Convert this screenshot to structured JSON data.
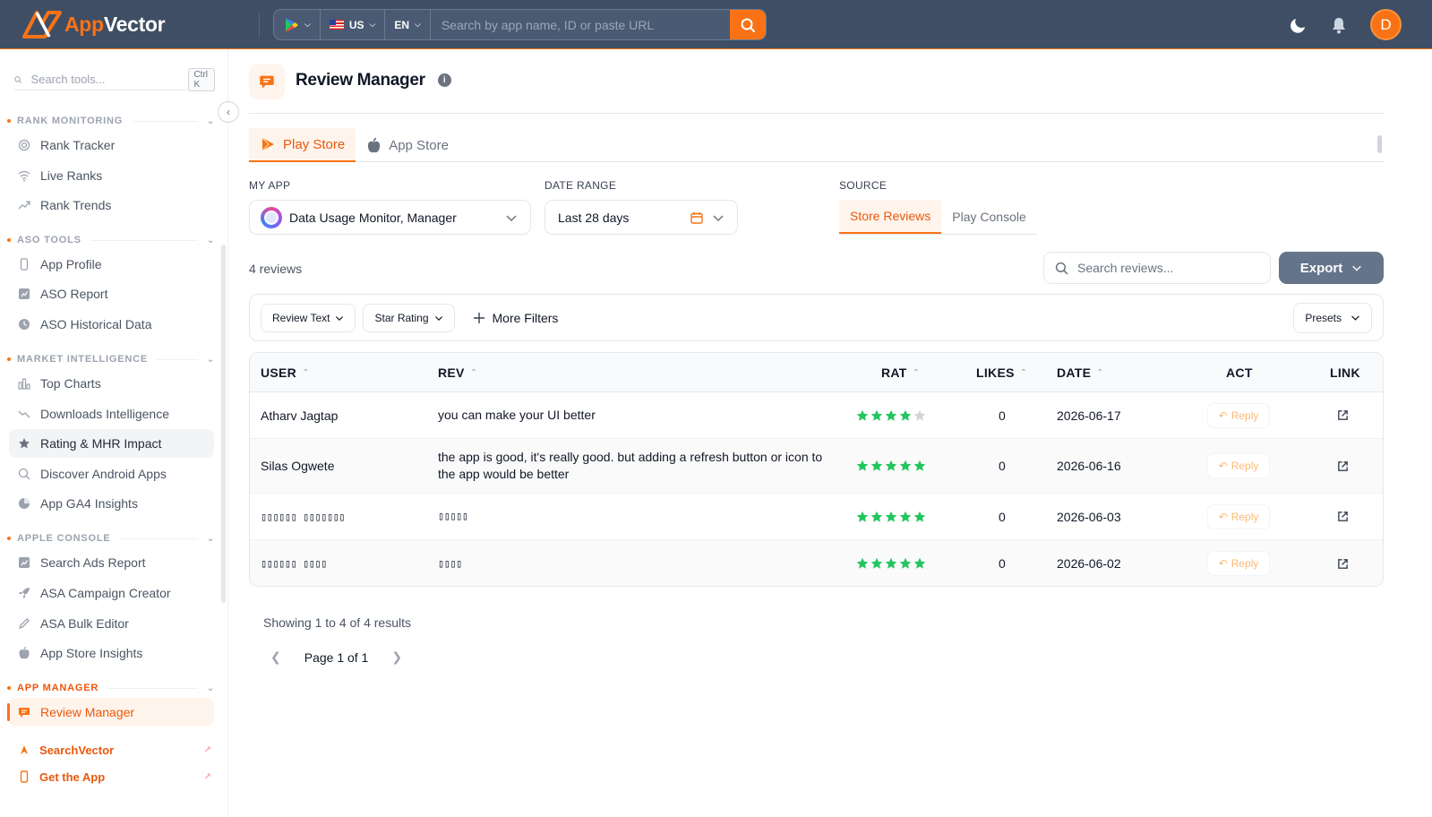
{
  "brand": {
    "name_part1": "App",
    "name_part2": "Vector"
  },
  "topbar": {
    "country": "US",
    "language": "EN",
    "search_placeholder": "Search by app name, ID or paste URL",
    "avatar_initial": "D"
  },
  "sidebar": {
    "search_placeholder": "Search tools...",
    "shortcut": "Ctrl K",
    "sections": {
      "rank": {
        "title": "RANK MONITORING",
        "items": [
          "Rank Tracker",
          "Live Ranks",
          "Rank Trends"
        ]
      },
      "aso": {
        "title": "ASO TOOLS",
        "items": [
          "App Profile",
          "ASO Report",
          "ASO Historical Data"
        ]
      },
      "market": {
        "title": "MARKET INTELLIGENCE",
        "items": [
          "Top Charts",
          "Downloads Intelligence",
          "Rating & MHR Impact",
          "Discover Android Apps",
          "App GA4 Insights"
        ]
      },
      "apple": {
        "title": "APPLE CONSOLE",
        "items": [
          "Search Ads Report",
          "ASA Campaign Creator",
          "ASA Bulk Editor",
          "App Store Insights"
        ]
      },
      "manager": {
        "title": "APP MANAGER",
        "items": [
          "Review Manager"
        ]
      }
    },
    "footer": [
      "SearchVector",
      "Get the App"
    ]
  },
  "page": {
    "title": "Review Manager",
    "store_tabs": [
      "Play Store",
      "App Store"
    ],
    "my_app_label": "MY APP",
    "my_app_value": "Data Usage Monitor, Manager",
    "date_label": "DATE RANGE",
    "date_value": "Last 28 days",
    "source_label": "SOURCE",
    "source_tabs": [
      "Store Reviews",
      "Play Console"
    ],
    "review_count": "4 reviews",
    "search_placeholder": "Search reviews...",
    "export_label": "Export",
    "filters": [
      "Review Text",
      "Star Rating"
    ],
    "more_filters": "More Filters",
    "presets": "Presets"
  },
  "table": {
    "columns": [
      "USER",
      "REV",
      "RAT",
      "LIKES",
      "DATE",
      "ACT",
      "LINK"
    ],
    "reply_label": "Reply",
    "rows": [
      {
        "user": "Atharv Jagtap",
        "review": "you can make your UI better",
        "rating": 4,
        "likes": "0",
        "date": "2026-06-17"
      },
      {
        "user": "Silas Ogwete",
        "review": "the app is good, it's really good. but adding a refresh button or icon to the app would be better",
        "rating": 5,
        "likes": "0",
        "date": "2026-06-16"
      },
      {
        "user": "▯▯▯▯▯▯ ▯▯▯▯▯▯▯",
        "review": "▯▯▯▯▯",
        "rating": 5,
        "likes": "0",
        "date": "2026-06-03"
      },
      {
        "user": "▯▯▯▯▯▯ ▯▯▯▯",
        "review": "▯▯▯▯",
        "rating": 5,
        "likes": "0",
        "date": "2026-06-02"
      }
    ]
  },
  "pagination": {
    "showing": "Showing 1 to 4 of 4 results",
    "page": "Page 1 of 1"
  },
  "colors": {
    "accent": "#f97316",
    "topbar": "#3f4e65",
    "star": "#22c55e",
    "star_empty": "#d1d5db"
  }
}
